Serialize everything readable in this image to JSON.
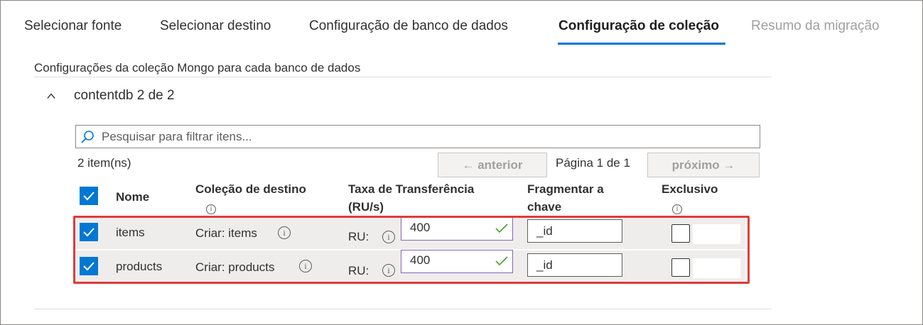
{
  "tabs": [
    {
      "label": "Selecionar fonte",
      "state": "normal"
    },
    {
      "label": "Selecionar destino",
      "state": "normal"
    },
    {
      "label": "Configuração de banco de dados",
      "state": "normal"
    },
    {
      "label": "Configuração de coleção",
      "state": "active"
    },
    {
      "label": "Resumo da migração",
      "state": "disabled"
    }
  ],
  "section_title": "Configurações da coleção Mongo para cada banco de dados",
  "group": {
    "title": "contentdb 2 de 2",
    "expanded": true
  },
  "search": {
    "placeholder": "Pesquisar para filtrar itens..."
  },
  "item_count": "2 item(ns)",
  "pagination": {
    "prev_label": "← anterior",
    "page_info": "Página 1 de 1",
    "next_label": "próximo →"
  },
  "table": {
    "headers": {
      "name": "Nome",
      "destination": "Coleção de destino",
      "throughput_line1": "Taxa de Transferência",
      "throughput_line2": "(RU/s)",
      "shard_line1": "Fragmentar a",
      "shard_line2": "chave",
      "unique": "Exclusivo"
    },
    "rows": [
      {
        "checked": true,
        "name": "items",
        "destination": "Criar: items",
        "ru_label": "RU:",
        "ru_value": "400",
        "shard_key": "_id",
        "unique": false
      },
      {
        "checked": true,
        "name": "products",
        "destination": "Criar: products",
        "ru_label": "RU:",
        "ru_value": "400",
        "shard_key": "_id",
        "unique": false
      }
    ]
  },
  "colors": {
    "accent": "#0078d4",
    "highlight": "#e03b3b",
    "valid": "#107c10"
  }
}
